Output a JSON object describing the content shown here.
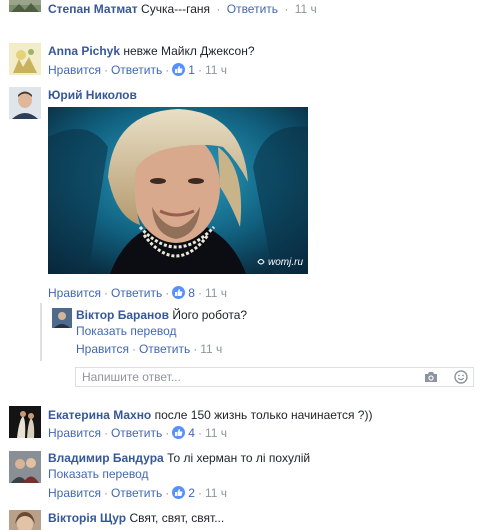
{
  "actions": {
    "like": "Нравится",
    "reply": "Ответить",
    "dot": "·"
  },
  "comments": [
    {
      "author": "Степан Матмат",
      "text": "Сучка---ганя",
      "likes": "",
      "time": "11 ч"
    },
    {
      "author": "Anna Pichyk",
      "text": "невже Майкл Джексон?",
      "likes": "1",
      "time": "11 ч"
    },
    {
      "author": "Юрий Николов",
      "text": "",
      "likes": "8",
      "time": "11 ч",
      "image_watermark": "womj.ru"
    },
    {
      "author": "Віктор Баранов",
      "text": "Його робота?",
      "translate": "Показать перевод",
      "likes": "",
      "time": "11 ч"
    },
    {
      "author": "Екатерина Махно",
      "text": "после 150 жизнь только начинается ?))",
      "likes": "4",
      "time": "11 ч"
    },
    {
      "author": "Владимир Бандура",
      "text": "То лі херман то лі похулій",
      "translate": "Показать перевод",
      "likes": "2",
      "time": "11 ч"
    },
    {
      "author": "Вікторія Щур",
      "text": "Свят, свят, свят..."
    }
  ],
  "reply_input": {
    "placeholder": "Напишите ответ...",
    "value": ""
  },
  "icons": {
    "camera": "camera-icon",
    "emoji": "smiley-icon",
    "like": "thumbs-up-icon"
  },
  "colors": {
    "link": "#365899",
    "action": "#4267b2",
    "meta": "#90949c",
    "like_badge": "#5890ff"
  }
}
